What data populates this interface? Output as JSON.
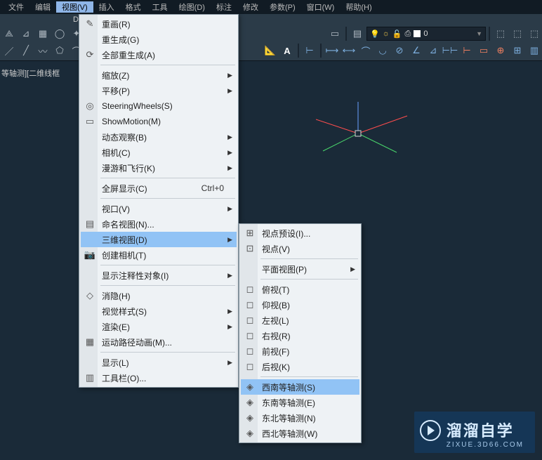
{
  "menubar": {
    "items": [
      "文件",
      "编辑",
      "视图(V)",
      "插入",
      "格式",
      "工具",
      "绘图(D)",
      "标注",
      "修改",
      "参数(P)",
      "窗口(W)",
      "帮助(H)"
    ],
    "active_index": 2
  },
  "drawing_tab": "Dr",
  "viewport_label": "等轴测][二维线框",
  "layer_combo": {
    "value": "0"
  },
  "view_menu": {
    "items": [
      {
        "icon": "pencil",
        "label": "重画(R)"
      },
      {
        "label": "重生成(G)"
      },
      {
        "icon": "regenall",
        "label": "全部重生成(A)"
      },
      {
        "sep": true
      },
      {
        "label": "缩放(Z)",
        "arrow": true
      },
      {
        "label": "平移(P)",
        "arrow": true
      },
      {
        "icon": "wheel",
        "label": "SteeringWheels(S)"
      },
      {
        "icon": "film",
        "label": "ShowMotion(M)"
      },
      {
        "label": "动态观察(B)",
        "arrow": true
      },
      {
        "label": "相机(C)",
        "arrow": true
      },
      {
        "label": "漫游和飞行(K)",
        "arrow": true
      },
      {
        "sep": true
      },
      {
        "label": "全屏显示(C)",
        "shortcut": "Ctrl+0"
      },
      {
        "sep": true
      },
      {
        "label": "视口(V)",
        "arrow": true
      },
      {
        "icon": "namedview",
        "label": "命名视图(N)..."
      },
      {
        "label": "三维视图(D)",
        "arrow": true,
        "highlight": true
      },
      {
        "icon": "camera",
        "label": "创建相机(T)"
      },
      {
        "sep": true
      },
      {
        "label": "显示注释性对象(I)",
        "arrow": true
      },
      {
        "sep": true
      },
      {
        "icon": "hide",
        "label": "消隐(H)"
      },
      {
        "label": "视觉样式(S)",
        "arrow": true
      },
      {
        "label": "渲染(E)",
        "arrow": true
      },
      {
        "icon": "anim",
        "label": "运动路径动画(M)..."
      },
      {
        "sep": true
      },
      {
        "label": "显示(L)",
        "arrow": true
      },
      {
        "icon": "toolbar",
        "label": "工具栏(O)..."
      }
    ]
  },
  "submenu_3d": {
    "items": [
      {
        "icon": "viewpoint",
        "label": "视点预设(I)..."
      },
      {
        "icon": "viewpoint2",
        "label": "视点(V)"
      },
      {
        "sep": true
      },
      {
        "label": "平面视图(P)",
        "arrow": true
      },
      {
        "sep": true
      },
      {
        "icon": "cube",
        "label": "俯视(T)"
      },
      {
        "icon": "cube",
        "label": "仰视(B)"
      },
      {
        "icon": "cube",
        "label": "左视(L)"
      },
      {
        "icon": "cube",
        "label": "右视(R)"
      },
      {
        "icon": "cube",
        "label": "前视(F)"
      },
      {
        "icon": "cube",
        "label": "后视(K)"
      },
      {
        "sep": true
      },
      {
        "icon": "iso",
        "label": "西南等轴测(S)",
        "highlight": true
      },
      {
        "icon": "iso",
        "label": "东南等轴测(E)"
      },
      {
        "icon": "iso",
        "label": "东北等轴测(N)"
      },
      {
        "icon": "iso",
        "label": "西北等轴测(W)"
      }
    ]
  },
  "watermark": {
    "title": "溜溜自学",
    "url": "ZIXUE.3D66.COM"
  }
}
